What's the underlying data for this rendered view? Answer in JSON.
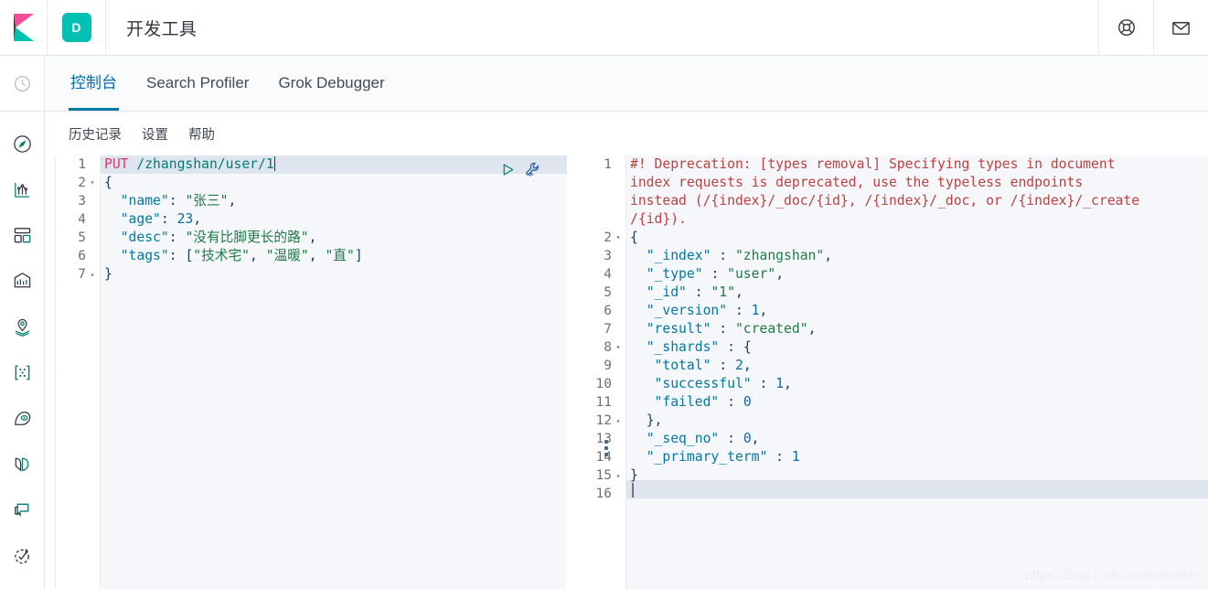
{
  "header": {
    "logo_name": "kibana-logo",
    "space_badge": "D",
    "app_title": "开发工具",
    "help_icon": "help-lifebuoy-icon",
    "mail_icon": "mail-envelope-icon",
    "brand_colors": {
      "pink": "#f04e98",
      "teal": "#00bfb3",
      "dark": "#343741",
      "accent_blue": "#0079a5"
    }
  },
  "rail": {
    "recent_icon": "recently-viewed-clock-icon",
    "items": [
      {
        "name": "discover-compass-icon"
      },
      {
        "name": "visualize-chart-icon"
      },
      {
        "name": "dashboard-grid-icon"
      },
      {
        "name": "canvas-presentation-icon"
      },
      {
        "name": "maps-location-icon"
      },
      {
        "name": "machine-learning-nodes-icon"
      },
      {
        "name": "infrastructure-eye-icon"
      },
      {
        "name": "logs-pages-icon"
      },
      {
        "name": "apm-monitor-icon"
      },
      {
        "name": "uptime-check-icon"
      }
    ]
  },
  "tabs": [
    {
      "label": "控制台",
      "active": true
    },
    {
      "label": "Search Profiler",
      "active": false
    },
    {
      "label": "Grok Debugger",
      "active": false
    }
  ],
  "subnav": [
    {
      "label": "历史记录"
    },
    {
      "label": "设置"
    },
    {
      "label": "帮助"
    }
  ],
  "editor": {
    "run_icon": "run-play-icon",
    "wrench_icon": "wrench-settings-icon",
    "drag_handle": "pane-resize-handle",
    "request": {
      "method": "PUT",
      "path": "/zhangshan/user/1",
      "lines": [
        {
          "n": "1",
          "fold": "",
          "html": "<span class='k-method'>PUT</span> <span class='k-url'>/zhangshan/user/1</span><span class='caret'></span>"
        },
        {
          "n": "2",
          "fold": "▾",
          "html": "<span class='k-punc'>{</span>"
        },
        {
          "n": "3",
          "fold": "",
          "html": "  <span class='k-key'>\"name\"</span><span class='k-punc'>:</span> <span class='k-str'>\"张三\"</span><span class='k-punc'>,</span>"
        },
        {
          "n": "4",
          "fold": "",
          "html": "  <span class='k-key'>\"age\"</span><span class='k-punc'>:</span> <span class='k-num'>23</span><span class='k-punc'>,</span>"
        },
        {
          "n": "5",
          "fold": "",
          "html": "  <span class='k-key'>\"desc\"</span><span class='k-punc'>:</span> <span class='k-str'>\"没有比脚更长的路\"</span><span class='k-punc'>,</span>"
        },
        {
          "n": "6",
          "fold": "",
          "html": "  <span class='k-key'>\"tags\"</span><span class='k-punc'>:</span> <span class='k-punc'>[</span><span class='k-str'>\"技术宅\"</span><span class='k-punc'>,</span> <span class='k-str'>\"温暖\"</span><span class='k-punc'>,</span> <span class='k-str'>\"直\"</span><span class='k-punc'>]</span>"
        },
        {
          "n": "7",
          "fold": "▴",
          "html": "<span class='k-punc'>}</span>"
        }
      ],
      "plain_text": "PUT /zhangshan/user/1\n{\n  \"name\": \"张三\",\n  \"age\": 23,\n  \"desc\": \"没有比脚更长的路\",\n  \"tags\": [\"技术宅\", \"温暖\", \"直\"]\n}"
    },
    "response": {
      "deprecation_warning": "#! Deprecation: [types removal] Specifying types in document index requests is deprecated, use the typeless endpoints instead (/{index}/_doc/{id}, /{index}/_doc, or /{index}/_create/{id}).",
      "body": {
        "_index": "zhangshan",
        "_type": "user",
        "_id": "1",
        "_version": 1,
        "result": "created",
        "_shards": {
          "total": 2,
          "successful": 1,
          "failed": 0
        },
        "_seq_no": 0,
        "_primary_term": 1
      },
      "lines": [
        {
          "n": "1",
          "fold": "",
          "html": "<span class='k-warn'>#! Deprecation: [types removal] Specifying types in document</span>"
        },
        {
          "n": "",
          "fold": "",
          "html": "<span class='k-warn'>index requests is deprecated, use the typeless endpoints</span>"
        },
        {
          "n": "",
          "fold": "",
          "html": "<span class='k-warn'>instead (/{index}/_doc/{id}, /{index}/_doc, or /{index}/_create</span>"
        },
        {
          "n": "",
          "fold": "",
          "html": "<span class='k-warn'>/{id}).</span>"
        },
        {
          "n": "2",
          "fold": "▾",
          "html": "<span class='k-punc'>{</span>"
        },
        {
          "n": "3",
          "fold": "",
          "html": "  <span class='k-key'>\"_index\"</span> <span class='k-punc'>:</span> <span class='k-str'>\"zhangshan\"</span><span class='k-punc'>,</span>"
        },
        {
          "n": "4",
          "fold": "",
          "html": "  <span class='k-key'>\"_type\"</span> <span class='k-punc'>:</span> <span class='k-str'>\"user\"</span><span class='k-punc'>,</span>"
        },
        {
          "n": "5",
          "fold": "",
          "html": "  <span class='k-key'>\"_id\"</span> <span class='k-punc'>:</span> <span class='k-str'>\"1\"</span><span class='k-punc'>,</span>"
        },
        {
          "n": "6",
          "fold": "",
          "html": "  <span class='k-key'>\"_version\"</span> <span class='k-punc'>:</span> <span class='k-num'>1</span><span class='k-punc'>,</span>"
        },
        {
          "n": "7",
          "fold": "",
          "html": "  <span class='k-key'>\"result\"</span> <span class='k-punc'>:</span> <span class='k-str'>\"created\"</span><span class='k-punc'>,</span>"
        },
        {
          "n": "8",
          "fold": "▾",
          "html": "  <span class='k-key'>\"_shards\"</span> <span class='k-punc'>:</span> <span class='k-punc'>{</span>"
        },
        {
          "n": "9",
          "fold": "",
          "html": "   <span class='k-key'>\"total\"</span> <span class='k-punc'>:</span> <span class='k-num'>2</span><span class='k-punc'>,</span>"
        },
        {
          "n": "10",
          "fold": "",
          "html": "   <span class='k-key'>\"successful\"</span> <span class='k-punc'>:</span> <span class='k-num'>1</span><span class='k-punc'>,</span>"
        },
        {
          "n": "11",
          "fold": "",
          "html": "   <span class='k-key'>\"failed\"</span> <span class='k-punc'>:</span> <span class='k-num'>0</span>"
        },
        {
          "n": "12",
          "fold": "▴",
          "html": "  <span class='k-punc'>},</span>"
        },
        {
          "n": "13",
          "fold": "",
          "html": "  <span class='k-key'>\"_seq_no\"</span> <span class='k-punc'>:</span> <span class='k-num'>0</span><span class='k-punc'>,</span>"
        },
        {
          "n": "14",
          "fold": "",
          "html": "  <span class='k-key'>\"_primary_term\"</span> <span class='k-punc'>:</span> <span class='k-num'>1</span>"
        },
        {
          "n": "15",
          "fold": "▴",
          "html": "<span class='k-punc'>}</span>"
        },
        {
          "n": "16",
          "fold": "",
          "html": ""
        }
      ]
    }
  },
  "watermark": "https://blog.csdn.net/sumatch"
}
